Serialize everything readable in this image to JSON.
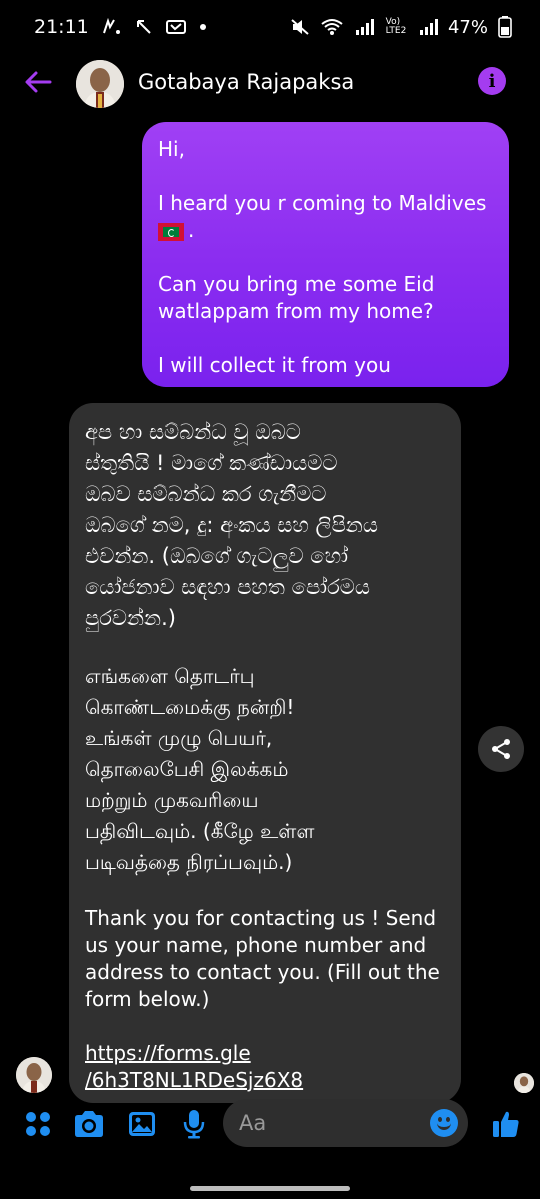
{
  "status_bar": {
    "time": "21:11",
    "battery": "47%",
    "net_label": "Vo)\nLTE2"
  },
  "header": {
    "contact_name": "Gotabaya Rajapaksa",
    "back_icon": "arrow-left-icon",
    "info_icon": "info-icon"
  },
  "colors": {
    "accent": "#a43cf0",
    "outgoing_bubble": "#9a36f2",
    "incoming_bubble": "#303030",
    "composer_icon": "#1f8ef1"
  },
  "outgoing_message": {
    "line1": "Hi,",
    "line2a": "I heard you r coming to Maldives",
    "line2b": ".",
    "line3": "Can you bring me some Eid watlappam from my home?",
    "line4": "I will collect it from you"
  },
  "incoming_message": {
    "sinhala": [
      "අප හා සම්බන්ධ වූ ඔබට",
      "ස්තුතියි ! මාගේ කණ්ඩායමට",
      "ඔබව සම්බන්ධ කර ගැනීමට",
      "ඔබගේ නම, දු: අංකය සහ ලිපිනය",
      "එවන්න. (ඔබගේ ගැටලුව හෝ",
      "යෝජනාව සඳහා පහත පෝරමය",
      "පුරවන්න.)"
    ],
    "tamil": [
      "எங்களை தொடர்பு",
      "கொண்டமைக்கு நன்றி!",
      "உங்கள் முழு பெயர்,",
      "தொலைபேசி இலக்கம்",
      "மற்றும் முகவரியை",
      "பதிவிடவும்.  (கீழே உள்ள",
      "படிவத்தை நிரப்பவும்.)"
    ],
    "english": "Thank you for contacting us ! Send us your name, phone number and address to contact you. (Fill out the form below.)",
    "link_line1": "https://forms.gle",
    "link_line2": "/6h3T8NL1RDeSjz6X8"
  },
  "composer": {
    "placeholder": "Aa"
  }
}
